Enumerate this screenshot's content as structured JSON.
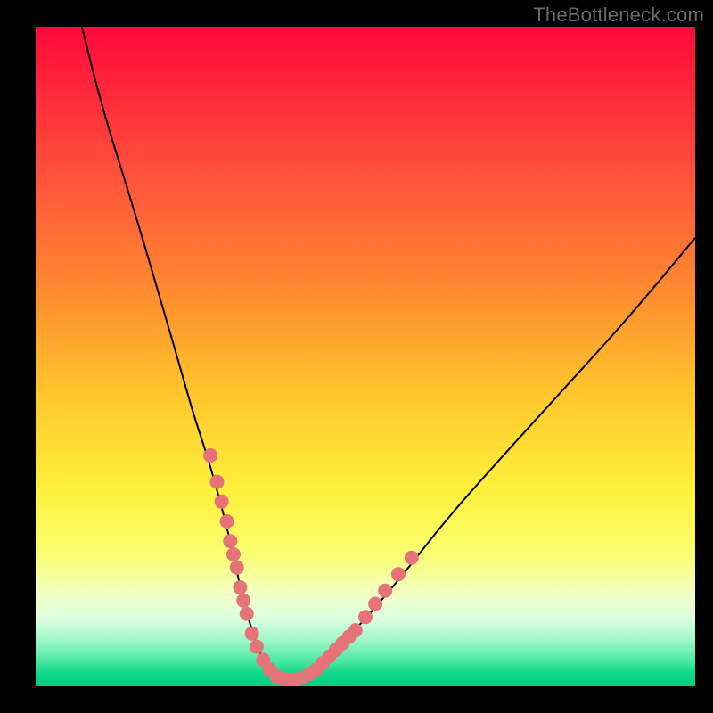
{
  "watermark": "TheBottleneck.com",
  "chart_data": {
    "type": "line",
    "title": "",
    "xlabel": "",
    "ylabel": "",
    "xlim": [
      0,
      100
    ],
    "ylim": [
      0,
      100
    ],
    "series": [
      {
        "name": "bottleneck-curve",
        "x": [
          7,
          10,
          15,
          20,
          22,
          24,
          26,
          28,
          30,
          31,
          32,
          33,
          34,
          35,
          36,
          37,
          38,
          40,
          42,
          44,
          48,
          55,
          62,
          70,
          80,
          90,
          100
        ],
        "y": [
          100,
          88,
          72,
          55,
          48,
          41,
          35,
          28,
          20,
          15,
          11,
          8,
          5,
          3,
          2,
          1.2,
          1,
          1,
          2,
          4,
          8,
          16,
          25,
          34,
          45,
          56,
          68
        ]
      }
    ],
    "markers": {
      "name": "highlight-dots",
      "color": "#e57377",
      "points": [
        {
          "x": 26.5,
          "y": 35
        },
        {
          "x": 27.5,
          "y": 31
        },
        {
          "x": 28.2,
          "y": 28
        },
        {
          "x": 29.0,
          "y": 25
        },
        {
          "x": 29.5,
          "y": 22
        },
        {
          "x": 30.0,
          "y": 20
        },
        {
          "x": 30.5,
          "y": 18
        },
        {
          "x": 31.0,
          "y": 15
        },
        {
          "x": 31.5,
          "y": 13
        },
        {
          "x": 32.0,
          "y": 11
        },
        {
          "x": 32.8,
          "y": 8
        },
        {
          "x": 33.5,
          "y": 6
        },
        {
          "x": 34.5,
          "y": 4
        },
        {
          "x": 35.5,
          "y": 2.5
        },
        {
          "x": 36.5,
          "y": 1.5
        },
        {
          "x": 37.5,
          "y": 1.1
        },
        {
          "x": 38.5,
          "y": 1.0
        },
        {
          "x": 39.5,
          "y": 1.0
        },
        {
          "x": 40.5,
          "y": 1.3
        },
        {
          "x": 41.5,
          "y": 1.8
        },
        {
          "x": 42.5,
          "y": 2.5
        },
        {
          "x": 43.5,
          "y": 3.5
        },
        {
          "x": 44.5,
          "y": 4.5
        },
        {
          "x": 45.5,
          "y": 5.5
        },
        {
          "x": 46.5,
          "y": 6.5
        },
        {
          "x": 47.5,
          "y": 7.5
        },
        {
          "x": 48.5,
          "y": 8.5
        },
        {
          "x": 50.0,
          "y": 10.5
        },
        {
          "x": 51.5,
          "y": 12.5
        },
        {
          "x": 53.0,
          "y": 14.5
        },
        {
          "x": 55.0,
          "y": 17.0
        },
        {
          "x": 57.0,
          "y": 19.5
        }
      ]
    }
  }
}
